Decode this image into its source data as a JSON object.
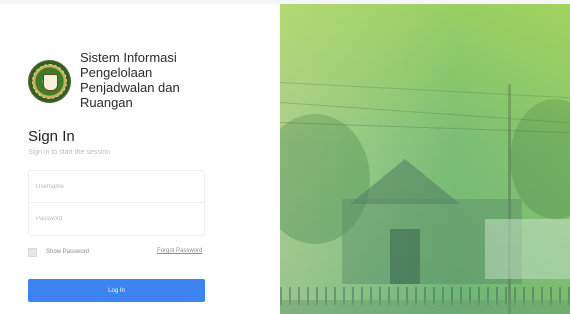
{
  "app": {
    "title_lines": [
      "Sistem Informasi",
      "Pengelolaan",
      "Penjadwalan dan",
      "Ruangan"
    ]
  },
  "signin": {
    "heading": "Sign In",
    "subtitle": "Sign in to start the session",
    "username_placeholder": "Username",
    "password_placeholder": "Password",
    "show_password_label": "Show Password",
    "forgot_password_link": "Forgot Password",
    "login_button": "Log In"
  },
  "colors": {
    "accent": "#3d84f1",
    "hero_tint": "#9ccc8c"
  },
  "icons": {
    "logo": "institution-emblem"
  }
}
